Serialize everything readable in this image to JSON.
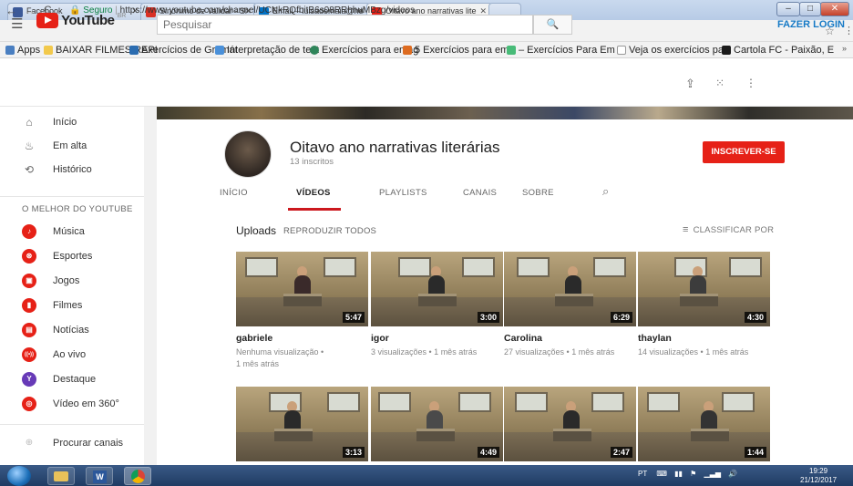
{
  "browser": {
    "tabs": [
      {
        "label": "Facebook",
        "color": "#3b5998"
      },
      {
        "label": "Sinônimo de Validar - Si",
        "color": "#d93025"
      },
      {
        "label": "Email – luisademaia@ho",
        "color": "#0072c6"
      },
      {
        "label": "Oitavo ano narrativas lite",
        "color": "#e62117"
      }
    ],
    "url_secure": "Seguro",
    "url": "https://www.youtube.com/channel/UCNkRQfbitB6s08RRhhuMBzg/videos",
    "bookmarks": [
      {
        "label": "Apps",
        "color": "#4a7fc1"
      },
      {
        "label": "BAIXAR FILMES RAPI",
        "color": "#f2c94c"
      },
      {
        "label": "Exercícios de Gramát",
        "color": "#2b6cb0"
      },
      {
        "label": "Interpretação de text",
        "color": "#4a90d9"
      },
      {
        "label": "Exercícios para emag",
        "color": "#2f855a"
      },
      {
        "label": "5 Exercícios para ema",
        "color": "#dd6b20"
      },
      {
        "label": "– Exercícios Para Em",
        "color": "#48bb78"
      },
      {
        "label": "Veja os exercícios pa",
        "color": "#cccccc"
      },
      {
        "label": "Cartola FC - Paixão, E",
        "color": "#1a1a1a"
      }
    ]
  },
  "youtube": {
    "logo_word": "YouTube",
    "logo_region": "BR",
    "search_placeholder": "Pesquisar",
    "login_label": "FAZER LOGIN"
  },
  "sidebar": {
    "main_items": [
      {
        "label": "Início",
        "icon": "⌂"
      },
      {
        "label": "Em alta",
        "icon": "♨"
      },
      {
        "label": "Histórico",
        "icon": "⟲"
      }
    ],
    "section_title": "O MELHOR DO YOUTUBE",
    "best_items": [
      {
        "label": "Música",
        "icon": "♪",
        "color": "#e62117"
      },
      {
        "label": "Esportes",
        "icon": "⊛",
        "color": "#e62117"
      },
      {
        "label": "Jogos",
        "icon": "▣",
        "color": "#e62117"
      },
      {
        "label": "Filmes",
        "icon": "▮",
        "color": "#e62117"
      },
      {
        "label": "Notícias",
        "icon": "▤",
        "color": "#e62117"
      },
      {
        "label": "Ao vivo",
        "icon": "((•))",
        "color": "#e62117"
      },
      {
        "label": "Destaque",
        "icon": "Y",
        "color": "#673ab7"
      },
      {
        "label": "Vídeo em 360°",
        "icon": "◎",
        "color": "#e62117"
      }
    ],
    "browse_label": "Procurar canais"
  },
  "channel": {
    "name": "Oitavo ano narrativas literárias",
    "subscribers": "13 inscritos",
    "subscribe_label": "INSCREVER-SE",
    "tabs": [
      "INÍCIO",
      "VÍDEOS",
      "PLAYLISTS",
      "CANAIS",
      "SOBRE"
    ],
    "active_tab": "VÍDEOS",
    "uploads_label": "Uploads",
    "play_all_label": "REPRODUZIR TODOS",
    "sort_label": "CLASSIFICAR POR"
  },
  "videos": [
    {
      "title": "gabriele",
      "duration": "5:47",
      "meta1": "Nenhuma visualização •",
      "meta2": "1 mês atrás"
    },
    {
      "title": "igor",
      "duration": "3:00",
      "meta1": "3 visualizações • 1 mês atrás",
      "meta2": ""
    },
    {
      "title": "Carolina",
      "duration": "6:29",
      "meta1": "27 visualizações • 1 mês atrás",
      "meta2": ""
    },
    {
      "title": "thaylan",
      "duration": "4:30",
      "meta1": "14 visualizações • 1 mês atrás",
      "meta2": ""
    },
    {
      "title": "",
      "duration": "3:13",
      "meta1": "",
      "meta2": ""
    },
    {
      "title": "",
      "duration": "4:49",
      "meta1": "",
      "meta2": ""
    },
    {
      "title": "",
      "duration": "2:47",
      "meta1": "",
      "meta2": ""
    },
    {
      "title": "",
      "duration": "1:44",
      "meta1": "",
      "meta2": ""
    }
  ],
  "taskbar": {
    "lang": "PT",
    "time": "19:29",
    "date": "21/12/2017"
  }
}
